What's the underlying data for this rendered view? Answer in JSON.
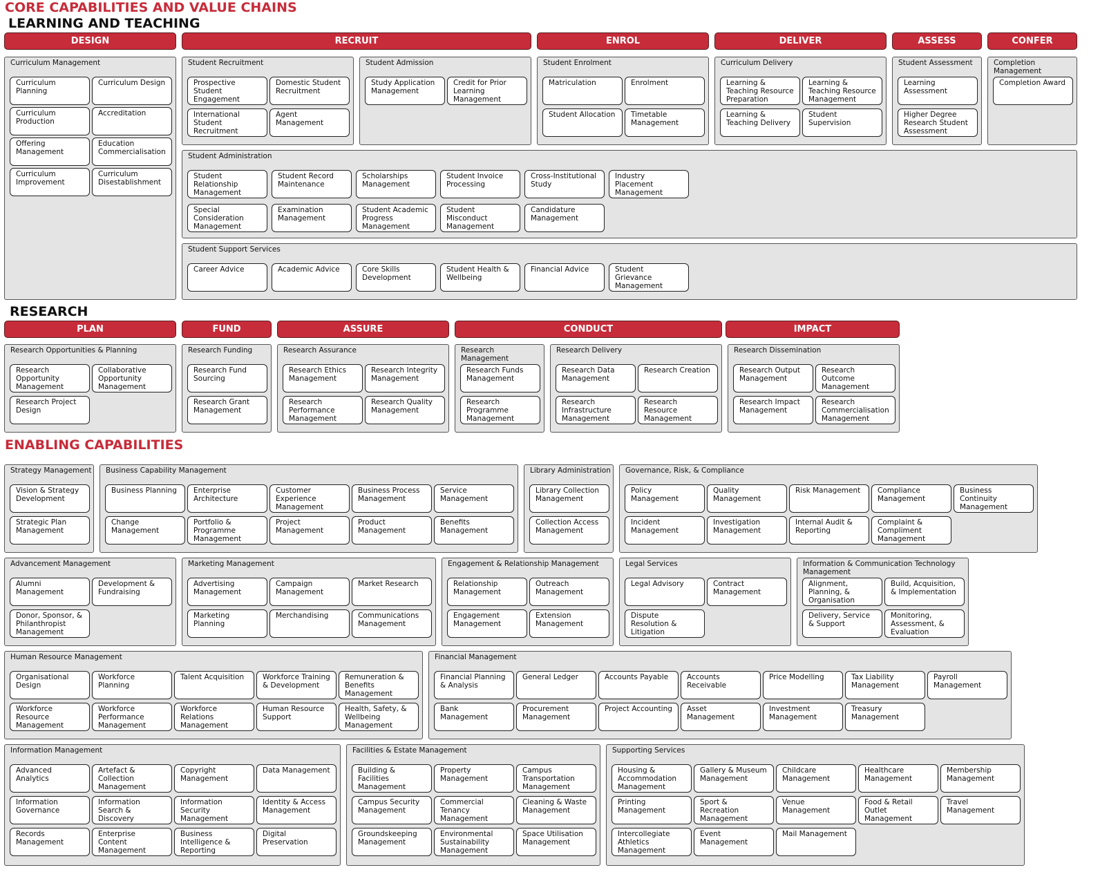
{
  "titles": {
    "core": "CORE CAPABILITIES AND VALUE CHAINS",
    "learning": "LEARNING AND TEACHING",
    "research": "RESEARCH",
    "enabling": "ENABLING CAPABILITIES"
  },
  "colors": {
    "accent": "#c72c3a",
    "group_bg": "#e4e4e4",
    "card_bg": "#ffffff"
  },
  "stages": {
    "learning": [
      "DESIGN",
      "RECRUIT",
      "ENROL",
      "DELIVER",
      "ASSESS",
      "CONFER"
    ],
    "research": [
      "PLAN",
      "FUND",
      "ASSURE",
      "CONDUCT",
      "IMPACT"
    ]
  },
  "groups": [
    {
      "id": "curriculum-management",
      "title": "Curriculum Management",
      "items": [
        "Curriculum Planning",
        "Curriculum Design",
        "Curriculum Production",
        "Accreditation",
        "Offering Management",
        "Education Commercialisation",
        "Curriculum Improvement",
        "Curriculum Disestablishment"
      ]
    },
    {
      "id": "student-recruitment",
      "title": "Student Recruitment",
      "items": [
        "Prospective Student Engagement",
        "Domestic Student Recruitment",
        "International Student Recruitment",
        "Agent Management"
      ]
    },
    {
      "id": "student-admission",
      "title": "Student Admission",
      "items": [
        "Study Application Management",
        "Credit for Prior Learning Management"
      ]
    },
    {
      "id": "student-enrolment",
      "title": "Student Enrolment",
      "items": [
        "Matriculation",
        "Enrolment",
        "Student Allocation",
        "Timetable Management"
      ]
    },
    {
      "id": "curriculum-delivery",
      "title": "Curriculum Delivery",
      "items": [
        "Learning & Teaching Resource Preparation",
        "Learning & Teaching Resource Management",
        "Learning & Teaching Delivery",
        "Student Supervision"
      ]
    },
    {
      "id": "student-assessment",
      "title": "Student Assessment",
      "items": [
        "Learning Assessment",
        "Higher Degree Research Student Assessment"
      ]
    },
    {
      "id": "completion-management",
      "title": "Completion Management",
      "items": [
        "Completion Award"
      ]
    },
    {
      "id": "student-administration",
      "title": "Student Administration",
      "items": [
        "Student Relationship Management",
        "Student Record Maintenance",
        "Scholarships Management",
        "Student Invoice Processing",
        "Cross-Institutional Study",
        "Industry Placement Management",
        "Special Consideration Management",
        "Examination Management",
        "Student Academic Progress Management",
        "Student Misconduct Management",
        "Candidature Management"
      ]
    },
    {
      "id": "student-support-services",
      "title": "Student Support Services",
      "items": [
        "Career Advice",
        "Academic Advice",
        "Core Skills Development",
        "Student Health & Wellbeing",
        "Financial Advice",
        "Student Grievance Management"
      ]
    },
    {
      "id": "research-opportunities-planning",
      "title": "Research Opportunities & Planning",
      "items": [
        "Research Opportunity Management",
        "Collaborative Opportunity Management",
        "Research Project Design"
      ]
    },
    {
      "id": "research-funding",
      "title": "Research Funding",
      "items": [
        "Research Fund Sourcing",
        "Research Grant Management"
      ]
    },
    {
      "id": "research-assurance",
      "title": "Research Assurance",
      "items": [
        "Research Ethics Management",
        "Research Integrity Management",
        "Research Performance Management",
        "Research Quality Management"
      ]
    },
    {
      "id": "research-management",
      "title": "Research Management",
      "items": [
        "Research Funds Management",
        "Research Programme Management"
      ]
    },
    {
      "id": "research-delivery",
      "title": "Research Delivery",
      "items": [
        "Research Data Management",
        "Research Creation",
        "Research Infrastructure Management",
        "Research Resource Management"
      ]
    },
    {
      "id": "research-dissemination",
      "title": "Research Dissemination",
      "items": [
        "Research Output Management",
        "Research Outcome Management",
        "Research Impact Management",
        "Research Commercialisation Management"
      ]
    },
    {
      "id": "strategy-management",
      "title": "Strategy Management",
      "items": [
        "Vision & Strategy Development",
        "Strategic Plan Management"
      ]
    },
    {
      "id": "business-capability-management",
      "title": "Business Capability Management",
      "items": [
        "Business Planning",
        "Enterprise Architecture",
        "Customer Experience Management",
        "Business Process Management",
        "Service Management",
        "Change Management",
        "Portfolio & Programme Management",
        "Project Management",
        "Product Management",
        "Benefits Management"
      ]
    },
    {
      "id": "library-administration",
      "title": "Library Administration",
      "items": [
        "Library Collection Management",
        "Collection Access Management"
      ]
    },
    {
      "id": "governance-risk-compliance",
      "title": "Governance, Risk, & Compliance",
      "items": [
        "Policy Management",
        "Quality Management",
        "Risk Management",
        "Compliance Management",
        "Business Continuity Management",
        "Incident Management",
        "Investigation Management",
        "Internal Audit & Reporting",
        "Complaint & Compliment Management"
      ]
    },
    {
      "id": "advancement-management",
      "title": "Advancement Management",
      "items": [
        "Alumni Management",
        "Development & Fundraising",
        "Donor, Sponsor, & Philanthropist Management"
      ]
    },
    {
      "id": "marketing-management",
      "title": "Marketing Management",
      "items": [
        "Advertising Management",
        "Campaign Management",
        "Market Research",
        "Marketing Planning",
        "Merchandising",
        "Communications Management"
      ]
    },
    {
      "id": "engagement-relationship-management",
      "title": "Engagement & Relationship Management",
      "items": [
        "Relationship Management",
        "Outreach Management",
        "Engagement Management",
        "Extension Management"
      ]
    },
    {
      "id": "legal-services",
      "title": "Legal Services",
      "items": [
        "Legal Advisory",
        "Contract Management",
        "Dispute Resolution & Litigation"
      ]
    },
    {
      "id": "ict-management",
      "title": "Information & Communication Technology Management",
      "items": [
        "Alignment, Planning, & Organisation",
        "Build, Acquisition, & Implementation",
        "Delivery, Service & Support",
        "Monitoring, Assessment, & Evaluation"
      ]
    },
    {
      "id": "human-resource-management",
      "title": "Human Resource Management",
      "items": [
        "Organisational Design",
        "Workforce Planning",
        "Talent Acquisition",
        "Workforce Training & Development",
        "Remuneration & Benefits Management",
        "Workforce Resource Management",
        "Workforce Performance Management",
        "Workforce Relations Management",
        "Human Resource Support",
        "Health, Safety, & Wellbeing Management"
      ]
    },
    {
      "id": "financial-management",
      "title": "Financial Management",
      "items": [
        "Financial Planning & Analysis",
        "General Ledger",
        "Accounts Payable",
        "Accounts Receivable",
        "Price Modelling",
        "Tax Liability Management",
        "Payroll Management",
        "Bank Management",
        "Procurement Management",
        "Project Accounting",
        "Asset Management",
        "Investment Management",
        "Treasury Management"
      ]
    },
    {
      "id": "information-management",
      "title": "Information Management",
      "items": [
        "Advanced Analytics",
        "Artefact & Collection Management",
        "Copyright Management",
        "Data Management",
        "Information Governance",
        "Information Search & Discovery",
        "Information Security Management",
        "Identity & Access Management",
        "Records Management",
        "Enterprise Content Management",
        "Business Intelligence & Reporting",
        "Digital Preservation"
      ]
    },
    {
      "id": "facilities-estate-management",
      "title": "Facilities & Estate Management",
      "items": [
        "Building & Facilities Management",
        "Property Management",
        "Campus Transportation Management",
        "Campus Security Management",
        "Commercial Tenancy Management",
        "Cleaning & Waste Management",
        "Groundskeeping Management",
        "Environmental Sustainability Management",
        "Space Utilisation Management"
      ]
    },
    {
      "id": "supporting-services",
      "title": "Supporting Services",
      "items": [
        "Housing & Accommodation Management",
        "Gallery & Museum Management",
        "Childcare Management",
        "Healthcare Management",
        "Membership Management",
        "Printing Management",
        "Sport & Recreation Management",
        "Venue Management",
        "Food & Retail Outlet Management",
        "Travel Management",
        "Intercollegiate Athletics Management",
        "Event Management",
        "Mail Management"
      ]
    }
  ]
}
